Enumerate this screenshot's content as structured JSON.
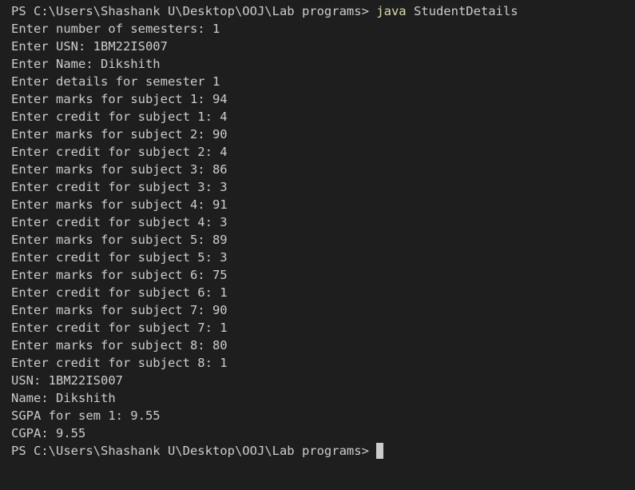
{
  "terminal": {
    "prompt": "PS C:\\Users\\Shashank U\\Desktop\\OOJ\\Lab programs>",
    "command": {
      "program": "java",
      "argument": "StudentDetails"
    },
    "output_lines": [
      "Enter number of semesters: 1",
      "Enter USN: 1BM22IS007",
      "Enter Name: Dikshith",
      "Enter details for semester 1",
      "Enter marks for subject 1: 94",
      "Enter credit for subject 1: 4",
      "Enter marks for subject 2: 90",
      "Enter credit for subject 2: 4",
      "Enter marks for subject 3: 86",
      "Enter credit for subject 3: 3",
      "Enter marks for subject 4: 91",
      "Enter credit for subject 4: 3",
      "Enter marks for subject 5: 89",
      "Enter credit for subject 5: 3",
      "Enter marks for subject 6: 75",
      "Enter credit for subject 6: 1",
      "Enter marks for subject 7: 90",
      "Enter credit for subject 7: 1",
      "Enter marks for subject 8: 80",
      "Enter credit for subject 8: 1",
      "USN: 1BM22IS007",
      "Name: Dikshith",
      "SGPA for sem 1: 9.55",
      "CGPA: 9.55"
    ],
    "final_prompt": "PS C:\\Users\\Shashank U\\Desktop\\OOJ\\Lab programs>"
  },
  "colors": {
    "background": "#1e1e1e",
    "text": "#cccccc",
    "command_highlight": "#dcdcaa"
  }
}
